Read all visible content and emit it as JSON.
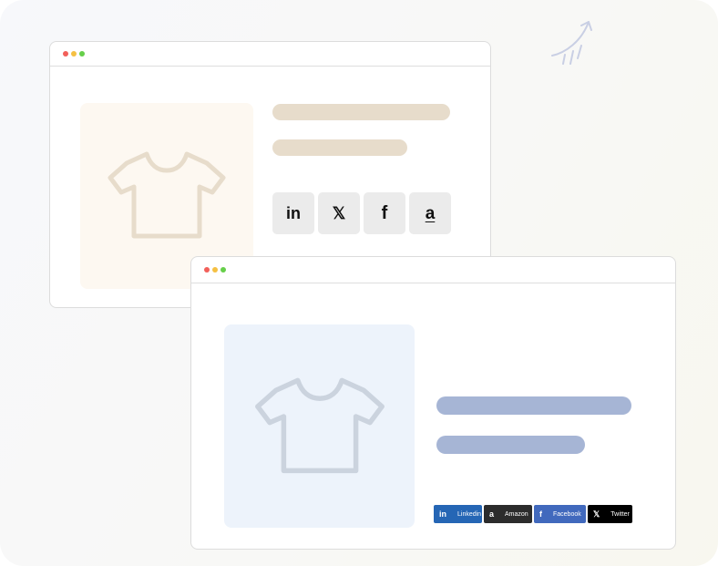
{
  "decor": {
    "arrow_icon": "curved-arrow-doodle-icon",
    "arrow_color": "#c9cfe4"
  },
  "window_back": {
    "dots": [
      "#f2605a",
      "#f5c043",
      "#66cf4a"
    ],
    "image_icon": "tshirt-icon",
    "image_bg": "#fdf8f1",
    "icon_stroke": "#e7dccb",
    "text_bar_color": "#e7dccb",
    "share_buttons": [
      {
        "icon": "linkedin-icon",
        "glyph": "in"
      },
      {
        "icon": "x-icon",
        "glyph": "𝕏"
      },
      {
        "icon": "facebook-icon",
        "glyph": "f"
      },
      {
        "icon": "amazon-icon",
        "glyph": "a"
      }
    ]
  },
  "window_front": {
    "dots": [
      "#f2605a",
      "#f5c043",
      "#66cf4a"
    ],
    "image_icon": "tshirt-icon",
    "image_bg": "#edf3fb",
    "icon_stroke": "#cbd3de",
    "text_bar_color": "#a6b5d5",
    "share_buttons": [
      {
        "icon": "linkedin-icon",
        "glyph": "in",
        "label": "Linkedin",
        "color": "#2566b5"
      },
      {
        "icon": "amazon-icon",
        "glyph": "a",
        "label": "Amazon",
        "color": "#2c2c2c"
      },
      {
        "icon": "facebook-icon",
        "glyph": "f",
        "label": "Facebook",
        "color": "#4169bd"
      },
      {
        "icon": "x-icon",
        "glyph": "𝕏",
        "label": "Twitter",
        "color": "#000000"
      }
    ]
  }
}
